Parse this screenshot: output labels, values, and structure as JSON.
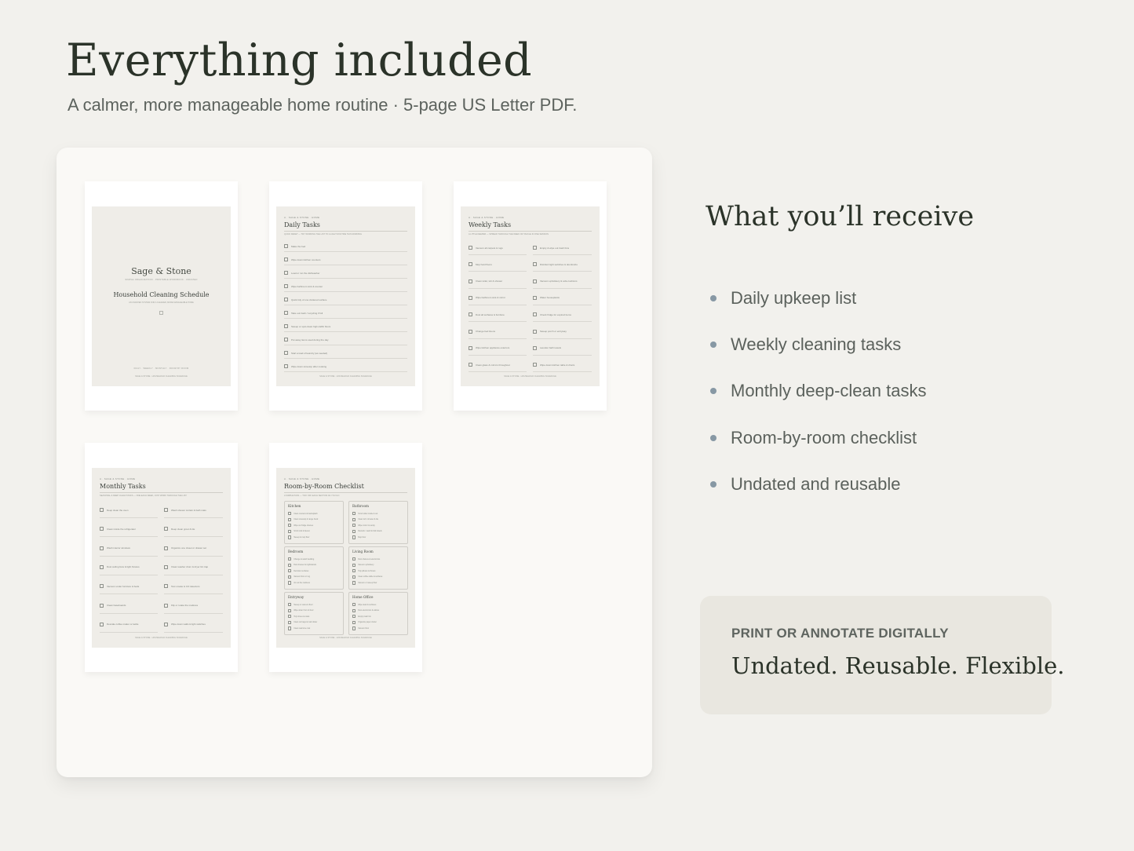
{
  "header": {
    "title": "Everything included",
    "subtitle": "A calmer, more manageable home routine · 5-page US Letter PDF."
  },
  "previews": {
    "cover": {
      "brand": "Sage & Stone",
      "tagline": "SIMPLE ORGANIZATION · PRINTABLE WORKBOOK · UNDATED",
      "title": "Household Cleaning Schedule",
      "subtitle": "AN UNDATED SYSTEM FOR A CLEANER, MORE MANAGEABLE HOME",
      "nav": "DAILY · WEEKLY · MONTHLY · ROOM BY ROOM",
      "footer": "SAGE & STONE · HOUSEHOLD CLEANING SCHEDULE"
    },
    "daily": {
      "tag": "A · SAGE & STONE · HOME",
      "title": "Daily Tasks",
      "note": "QUICK RESET — TRY WORKING THE LIST TO A LIGHT ROUTINE THIS MORNING",
      "items": [
        "Make the bed",
        "Wipe down kitchen counters",
        "Load or run the dishwasher",
        "Wipe bathroom sink & counter",
        "Quick tidy of one cluttered surface",
        "Take out trash / recycling if full",
        "Sweep or spot-clean high-traffic floors",
        "Put away items used during the day",
        "Start a load of laundry (as needed)",
        "Wipe down stovetop after cooking"
      ],
      "footer": "SAGE & STONE · HOUSEHOLD CLEANING SCHEDULE"
    },
    "weekly": {
      "tag": "A · SAGE & STONE · HOME",
      "title": "Weekly Tasks",
      "note": "A LITTLE DEEPER — SPREAD THROUGH THE WEEK OR TACKLE IN ONE SESSION",
      "left": [
        "Vacuum all carpets & rugs",
        "Mop hard floors",
        "Clean toilet, tub & shower",
        "Wipe bathroom sink & mirror",
        "Dust all surfaces & furniture",
        "Change bed linens",
        "Wipe kitchen appliance exteriors",
        "Clean glass & mirrors throughout"
      ],
      "right": [
        "Empty & wipe out trash bins",
        "Disinfect light switches & doorknobs",
        "Vacuum upholstery & sofa cushions",
        "Water houseplants",
        "Check fridge for expired items",
        "Sweep porch or entryway",
        "Launder bath towels",
        "Wipe down kitchen table & chairs"
      ],
      "footer": "SAGE & STONE · HOUSEHOLD CLEANING SCHEDULE"
    },
    "monthly": {
      "tag": "A · SAGE & STONE · HOME",
      "title": "Monthly Tasks",
      "note": "SEASONAL & DEEP CLEAN TASKS — ONE EACH WEEK, JUST WORK THROUGH THE LIST",
      "left": [
        "Deep clean the oven",
        "Clean inside the refrigerator",
        "Wash interior windows",
        "Dust ceiling fans & light fixtures",
        "Vacuum under furniture & beds",
        "Clean baseboards",
        "Descale coffee maker or kettle"
      ],
      "right": [
        "Wash shower curtain & bath mats",
        "Deep clean grout & tile",
        "Organize one closet or drawer set",
        "Clean washer drum & dryer lint trap",
        "Test smoke & CO detectors",
        "Flip or rotate the mattress",
        "Wipe down walls & light switches"
      ],
      "footer": "SAGE & STONE · HOUSEHOLD CLEANING SCHEDULE"
    },
    "rooms": {
      "tag": "A · SAGE & STONE · HOME",
      "title": "Room-by-Room Checklist",
      "note": "A SIMPLE PASS — TICK OFF EACH SECTION AS YOU GO",
      "boxes": [
        {
          "name": "Kitchen",
          "items": [
            "Clear counters & backsplash",
            "Clean stovetop & range hood",
            "Wipe out fridge shelves",
            "Scrub sink & faucet",
            "Sweep & mop floor"
          ]
        },
        {
          "name": "Bathroom",
          "items": [
            "Scrub toilet inside & out",
            "Clean tub / shower & tile",
            "Wipe mirror & vanity",
            "Restock / wash & fold towels",
            "Mop floor"
          ]
        },
        {
          "name": "Bedroom",
          "items": [
            "Change & wash bedding",
            "Dust dresser & nightstands",
            "Declutter surfaces",
            "Vacuum floor or rug",
            "Air out the mattress"
          ]
        },
        {
          "name": "Living Room",
          "items": [
            "Dust shelves & electronics",
            "Vacuum upholstery",
            "Tidy pillows & throws",
            "Clean coffee table & surfaces",
            "Vacuum or sweep floor"
          ]
        },
        {
          "name": "Entryway",
          "items": [
            "Sweep or vacuum floor",
            "Wipe down front of door",
            "Tidy shoes & coats",
            "Clear out bags & mail clutter",
            "Clean welcome mat"
          ]
        },
        {
          "name": "Home Office",
          "items": [
            "Wipe desk & surfaces",
            "Dust electronics & cables",
            "Empty trash bin",
            "Organize paper clutter",
            "Vacuum floor"
          ]
        }
      ],
      "footer": "SAGE & STONE · HOUSEHOLD CLEANING SCHEDULE"
    }
  },
  "receive": {
    "title": "What you’ll receive",
    "items": [
      "Daily upkeep list",
      "Weekly cleaning tasks",
      "Monthly deep-clean tasks",
      "Room-by-room checklist",
      "Undated and reusable"
    ],
    "bullet_color": "#8798a4"
  },
  "callout": {
    "eyebrow": "PRINT OR ANNOTATE DIGITALLY",
    "headline": "Undated. Reusable. Flexible."
  }
}
